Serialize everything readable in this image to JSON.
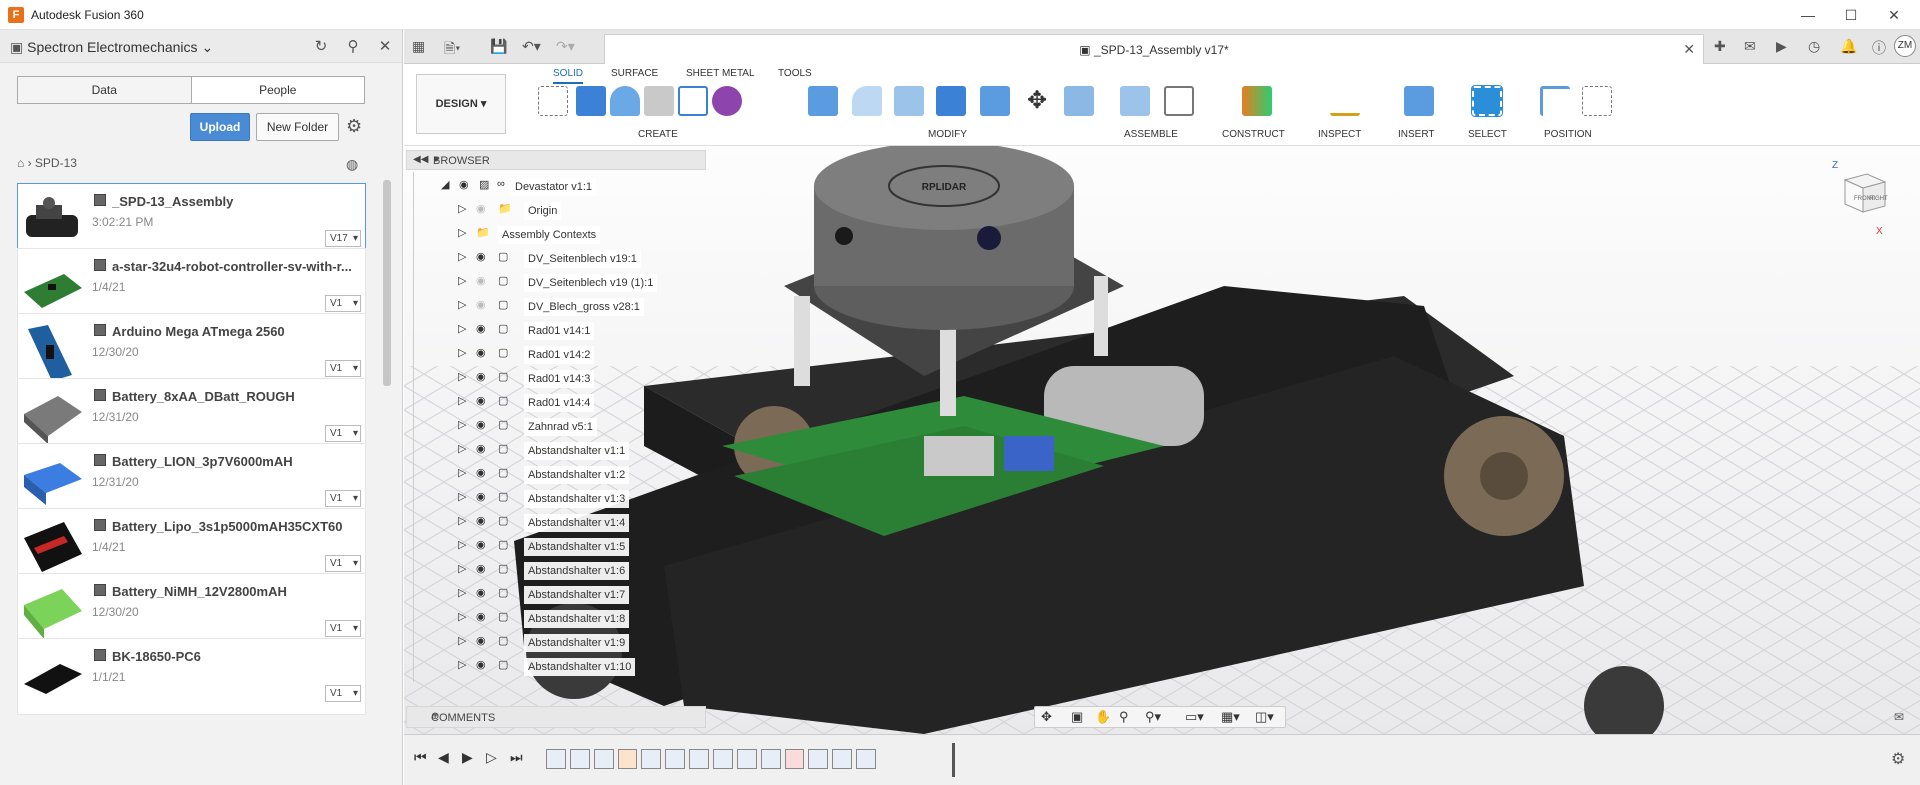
{
  "app": {
    "title": "Autodesk Fusion 360",
    "logo": "F"
  },
  "left_panel": {
    "team": "Spectron Electromechanics",
    "tabs": [
      "Data",
      "People"
    ],
    "upload": "Upload",
    "new_folder": "New Folder",
    "breadcrumb": "SPD-13",
    "files": [
      {
        "name": "_SPD-13_Assembly",
        "date": "3:02:21 PM",
        "version": "V17"
      },
      {
        "name": "a-star-32u4-robot-controller-sv-with-r...",
        "date": "1/4/21",
        "version": "V1"
      },
      {
        "name": "Arduino Mega ATmega 2560",
        "date": "12/30/20",
        "version": "V1"
      },
      {
        "name": "Battery_8xAA_DBatt_ROUGH",
        "date": "12/31/20",
        "version": "V1"
      },
      {
        "name": "Battery_LION_3p7V6000mAH",
        "date": "12/31/20",
        "version": "V1"
      },
      {
        "name": "Battery_Lipo_3s1p5000mAH35CXT60",
        "date": "1/4/21",
        "version": "V1"
      },
      {
        "name": "Battery_NiMH_12V2800mAH",
        "date": "12/30/20",
        "version": "V1"
      },
      {
        "name": "BK-18650-PC6",
        "date": "1/1/21",
        "version": "V1"
      }
    ]
  },
  "document": {
    "tab_title": "_SPD-13_Assembly v17*"
  },
  "ribbon": {
    "workspace": "DESIGN",
    "tabs": [
      "SOLID",
      "SURFACE",
      "SHEET METAL",
      "TOOLS"
    ],
    "groups": [
      "CREATE",
      "MODIFY",
      "ASSEMBLE",
      "CONSTRUCT",
      "INSPECT",
      "INSERT",
      "SELECT",
      "POSITION"
    ]
  },
  "browser": {
    "title": "BROWSER",
    "root": "Devastator v1:1",
    "items": [
      "Origin",
      "Assembly Contexts",
      "DV_Seitenblech v19:1",
      "DV_Seitenblech v19 (1):1",
      "DV_Blech_gross v28:1",
      "Rad01 v14:1",
      "Rad01 v14:2",
      "Rad01 v14:3",
      "Rad01 v14:4",
      "Zahnrad v5:1",
      "Abstandshalter v1:1",
      "Abstandshalter v1:2",
      "Abstandshalter v1:3",
      "Abstandshalter v1:4",
      "Abstandshalter v1:5",
      "Abstandshalter v1:6",
      "Abstandshalter v1:7",
      "Abstandshalter v1:8",
      "Abstandshalter v1:9",
      "Abstandshalter v1:10"
    ]
  },
  "comments": {
    "title": "COMMENTS"
  },
  "user": {
    "initials": "ZM"
  },
  "viewcube": {
    "front": "FRONT",
    "right": "RIGHT",
    "z": "Z",
    "x": "X"
  },
  "model": {
    "lidar_label": "RPLIDAR"
  },
  "colors": {
    "accent": "#1b6fb8",
    "upload": "#4a8bd6",
    "track": "#1e1e1e",
    "pcb": "#2e8b3a"
  }
}
